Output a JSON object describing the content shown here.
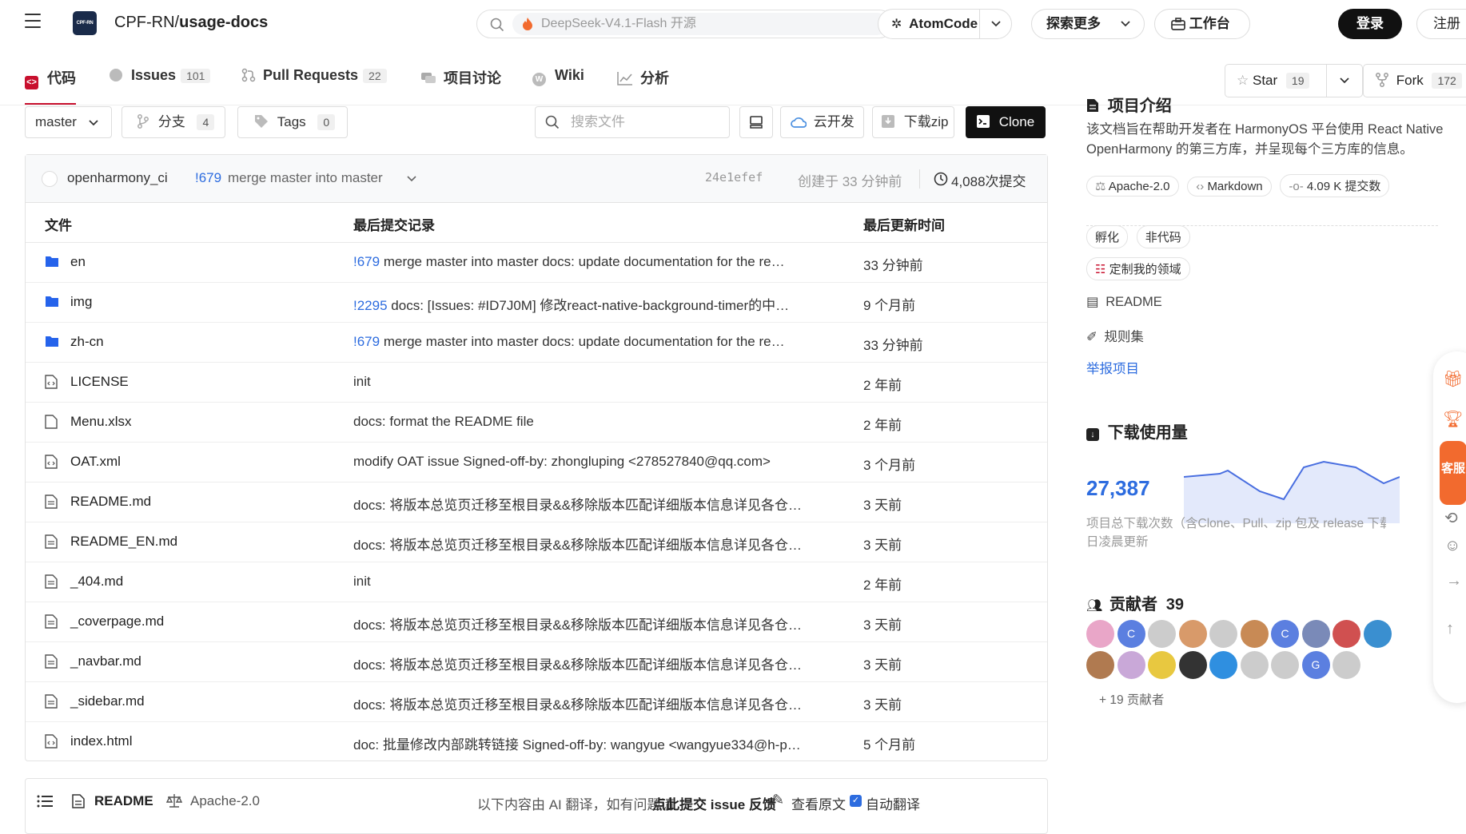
{
  "header": {
    "repo_owner": "CPF-RN/",
    "repo_name": "usage-docs",
    "logo_text": "CPF-RN",
    "search_placeholder": "DeepSeek-V4.1-Flash 开源",
    "atomcode": "AtomCode",
    "explore": "探索更多",
    "workbench": "工作台",
    "login": "登录",
    "register": "注册"
  },
  "tabs": [
    {
      "label": "代码"
    },
    {
      "label": "Issues",
      "count": "101"
    },
    {
      "label": "Pull Requests",
      "count": "22"
    },
    {
      "label": "项目讨论"
    },
    {
      "label": "Wiki"
    },
    {
      "label": "分析"
    }
  ],
  "star": {
    "label": "Star",
    "count": "19"
  },
  "fork": {
    "label": "Fork",
    "count": "172"
  },
  "toolbar": {
    "branch": "master",
    "branches_label": "分支",
    "branches_count": "4",
    "tags_label": "Tags",
    "tags_count": "0",
    "file_search_placeholder": "搜索文件",
    "cloud_dev": "云开发",
    "download_zip": "下载zip",
    "clone": "Clone"
  },
  "commit": {
    "author": "openharmony_ci",
    "pr": "!679",
    "message": "merge master into master",
    "hash": "24e1efef",
    "created": "创建于 33 分钟前",
    "count": "4,088次提交"
  },
  "table": {
    "col_file": "文件",
    "col_commit": "最后提交记录",
    "col_time": "最后更新时间",
    "rows": [
      {
        "name": "en",
        "type": "folder",
        "pr": "!679",
        "msg": "merge master into master docs: update documentation for the re…",
        "time": "33 分钟前"
      },
      {
        "name": "img",
        "type": "folder",
        "pr": "!2295",
        "msg": "docs: [Issues: #ID7J0M] 修改react-native-background-timer的中…",
        "time": "9 个月前"
      },
      {
        "name": "zh-cn",
        "type": "folder",
        "pr": "!679",
        "msg": "merge master into master docs: update documentation for the re…",
        "time": "33 分钟前"
      },
      {
        "name": "LICENSE",
        "type": "code",
        "pr": "",
        "msg": "init",
        "time": "2 年前"
      },
      {
        "name": "Menu.xlsx",
        "type": "file",
        "pr": "",
        "msg": "docs: format the README file",
        "time": "2 年前"
      },
      {
        "name": "OAT.xml",
        "type": "code",
        "pr": "",
        "msg": "modify OAT issue Signed-off-by: zhongluping <278527840@qq.com>",
        "time": "3 个月前"
      },
      {
        "name": "README.md",
        "type": "doc",
        "pr": "",
        "msg": "docs: 将版本总览页迁移至根目录&&移除版本匹配详细版本信息详见各仓…",
        "time": "3 天前"
      },
      {
        "name": "README_EN.md",
        "type": "doc",
        "pr": "",
        "msg": "docs: 将版本总览页迁移至根目录&&移除版本匹配详细版本信息详见各仓…",
        "time": "3 天前"
      },
      {
        "name": "_404.md",
        "type": "doc",
        "pr": "",
        "msg": "init",
        "time": "2 年前"
      },
      {
        "name": "_coverpage.md",
        "type": "doc",
        "pr": "",
        "msg": "docs: 将版本总览页迁移至根目录&&移除版本匹配详细版本信息详见各仓…",
        "time": "3 天前"
      },
      {
        "name": "_navbar.md",
        "type": "doc",
        "pr": "",
        "msg": "docs: 将版本总览页迁移至根目录&&移除版本匹配详细版本信息详见各仓…",
        "time": "3 天前"
      },
      {
        "name": "_sidebar.md",
        "type": "doc",
        "pr": "",
        "msg": "docs: 将版本总览页迁移至根目录&&移除版本匹配详细版本信息详见各仓…",
        "time": "3 天前"
      },
      {
        "name": "index.html",
        "type": "code",
        "pr": "",
        "msg": "doc: 批量修改内部跳转链接 Signed-off-by: wangyue <wangyue334@h-p…",
        "time": "5 个月前"
      }
    ]
  },
  "readme": {
    "title": "README",
    "license": "Apache-2.0",
    "ai_note": "以下内容由 AI 翻译，如有问题请",
    "ai_link": "点此提交 issue 反馈",
    "view_original": "查看原文",
    "auto_translate": "自动翻译"
  },
  "sidebar": {
    "intro_title": "项目介绍",
    "intro_text": "该文档旨在帮助开发者在 HarmonyOS 平台使用 React Native OpenHarmony 的第三方库，并呈现每个三方库的信息。",
    "badges": [
      "Apache-2.0",
      "Markdown",
      "4.09 K 提交数"
    ],
    "tags": [
      "孵化",
      "非代码"
    ],
    "custom_domain": "定制我的领域",
    "readme_link": "README",
    "rules_link": "规则集",
    "report": "举报项目",
    "downloads_title": "下载使用量",
    "downloads_value": "27,387",
    "downloads_note": "项目总下载次数（含Clone、Pull、zip 包及 release 下载）",
    "downloads_note2": "日凌晨更新",
    "contributors_title": "贡献者",
    "contributors_count": "39",
    "more_contributors": "+ 19 贡献者"
  },
  "floatbar": {
    "service": "客服"
  },
  "colors": {
    "accent": "#c8102e",
    "link": "#2d6cdf",
    "chart_fill": "#e3e9fb",
    "chart_line": "#4a6fe0"
  }
}
